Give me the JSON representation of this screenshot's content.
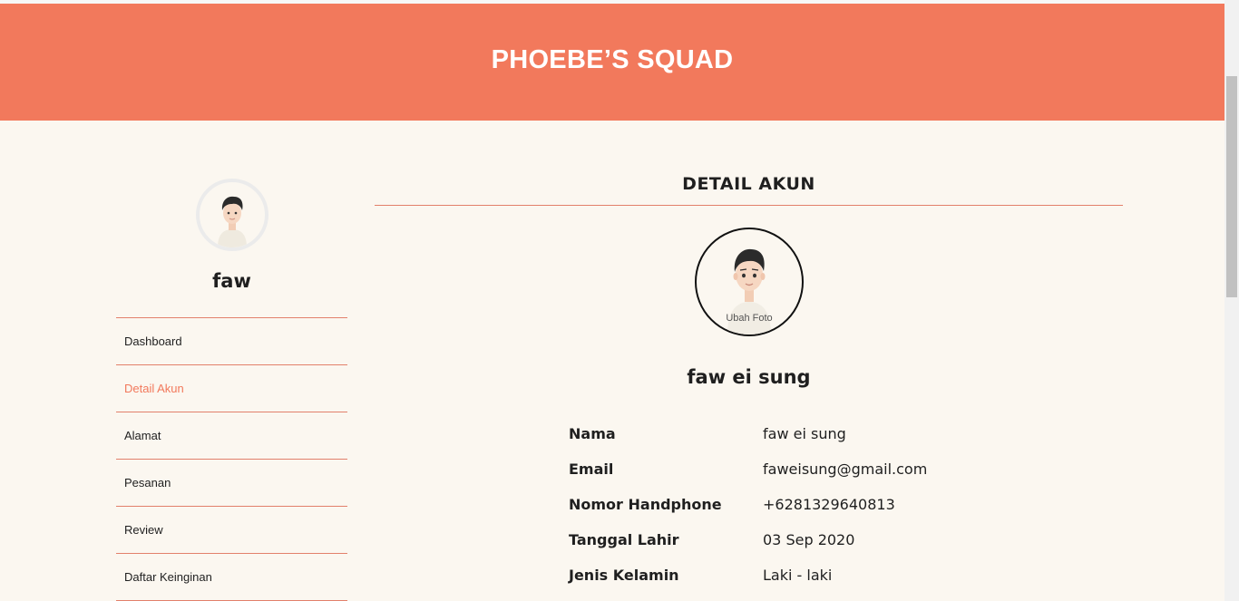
{
  "header": {
    "brand": "PHOEBE’S SQUAD"
  },
  "sidebar": {
    "username": "faw",
    "menu": [
      {
        "label": "Dashboard",
        "active": false
      },
      {
        "label": "Detail Akun",
        "active": true
      },
      {
        "label": "Alamat",
        "active": false
      },
      {
        "label": "Pesanan",
        "active": false
      },
      {
        "label": "Review",
        "active": false
      },
      {
        "label": "Daftar Keinginan",
        "active": false
      }
    ]
  },
  "main": {
    "section_title": "DETAIL AKUN",
    "avatar": {
      "change_photo_label": "Ubah Foto"
    },
    "profile_name": "faw ei sung",
    "details": [
      {
        "label": "Nama",
        "value": "faw ei sung"
      },
      {
        "label": "Email",
        "value": "faweisung@gmail.com"
      },
      {
        "label": "Nomor Handphone",
        "value": "+6281329640813"
      },
      {
        "label": "Tanggal Lahir",
        "value": "03 Sep 2020"
      },
      {
        "label": "Jenis Kelamin",
        "value": "Laki - laki"
      }
    ]
  },
  "colors": {
    "brand_accent": "#f2795c",
    "background": "#fbf7f0",
    "divider": "#e2806b"
  }
}
